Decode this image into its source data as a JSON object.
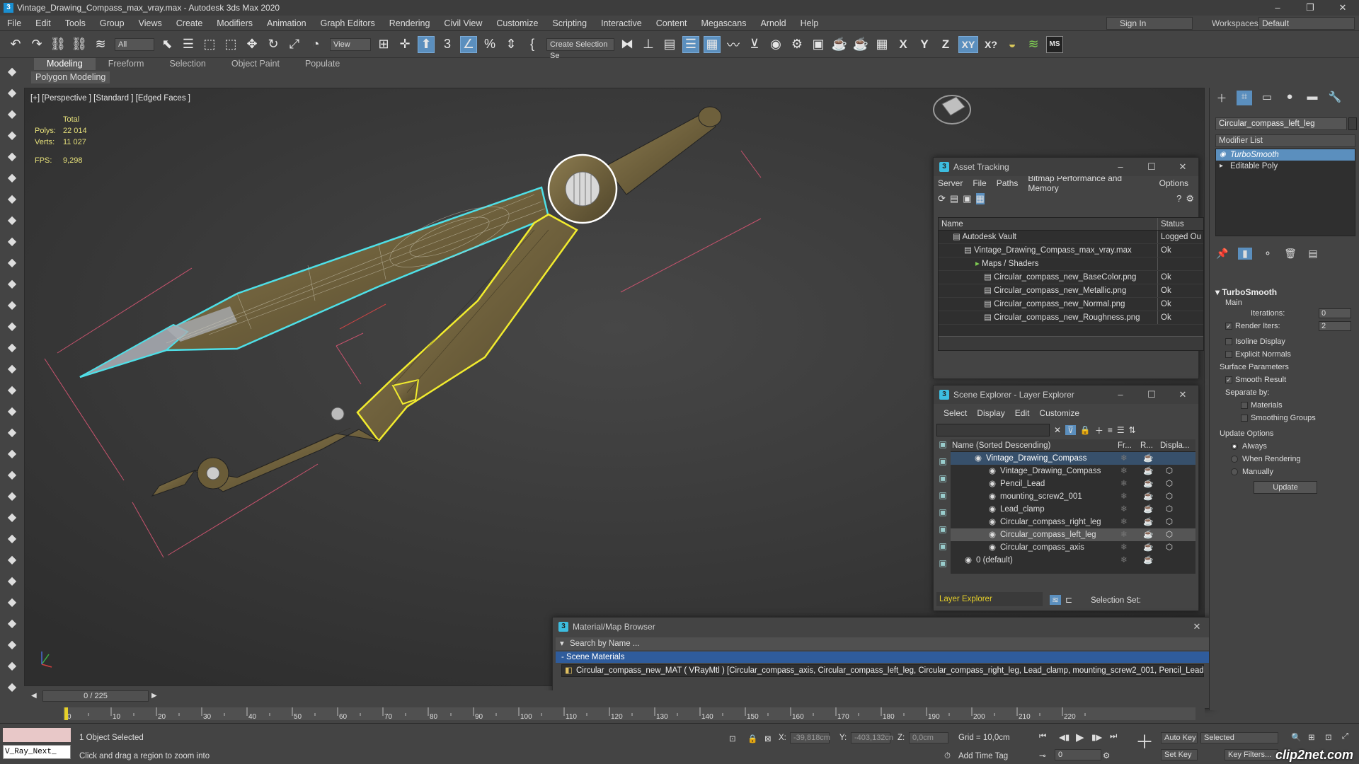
{
  "app": {
    "title": "Vintage_Drawing_Compass_max_vray.max - Autodesk 3ds Max 2020",
    "icon": "3",
    "accent": "#5b8fbe"
  },
  "window_controls": {
    "minimize": "–",
    "maximize": "❐",
    "close": "✕"
  },
  "menu": [
    "File",
    "Edit",
    "Tools",
    "Group",
    "Views",
    "Create",
    "Modifiers",
    "Animation",
    "Graph Editors",
    "Rendering",
    "Civil View",
    "Customize",
    "Scripting",
    "Interactive",
    "Content",
    "Megascans",
    "Arnold",
    "Help"
  ],
  "signin": "Sign In",
  "workspaces": {
    "label": "Workspaces:",
    "value": "Default"
  },
  "toolbar": {
    "filter": "All",
    "view": "View",
    "selection_set": "Create Selection Se",
    "axis_x": "X",
    "axis_y": "Y",
    "axis_z": "Z",
    "axis_xy": "XY",
    "axis_xq": "X?",
    "ms_label": "MS"
  },
  "ribbon": {
    "tabs": [
      "Modeling",
      "Freeform",
      "Selection",
      "Object Paint",
      "Populate"
    ],
    "sub": "Polygon Modeling"
  },
  "viewport": {
    "label": "[+] [Perspective ] [Standard ] [Edged Faces ]",
    "stats": {
      "total": "Total",
      "polys_label": "Polys:",
      "polys": "22 014",
      "verts_label": "Verts:",
      "verts": "11 027",
      "fps_label": "FPS:",
      "fps": "9,298"
    }
  },
  "command_panel": {
    "object_name": "Circular_compass_left_leg",
    "modifier_list": "Modifier List",
    "stack": [
      "TurboSmooth",
      "Editable Poly"
    ],
    "turbosmooth": {
      "title": "TurboSmooth",
      "main": "Main",
      "iterations_label": "Iterations:",
      "iterations": "0",
      "render_iters_label": "Render Iters:",
      "render_iters": "2",
      "isoline": "Isoline Display",
      "explicit": "Explicit Normals",
      "surface": "Surface Parameters",
      "smooth": "Smooth Result",
      "separate": "Separate by:",
      "materials": "Materials",
      "smoothing": "Smoothing Groups",
      "update_options": "Update Options",
      "always": "Always",
      "when_rendering": "When Rendering",
      "manually": "Manually",
      "update_btn": "Update"
    }
  },
  "asset_tracking": {
    "title": "Asset Tracking",
    "menu": [
      "Server",
      "File",
      "Paths",
      "Bitmap Performance and Memory",
      "Options"
    ],
    "col_name": "Name",
    "col_status": "Status",
    "rows": [
      {
        "name": "Autodesk Vault",
        "status": "Logged Ou"
      },
      {
        "name": "Vintage_Drawing_Compass_max_vray.max",
        "status": "Ok"
      },
      {
        "name": "Maps / Shaders",
        "status": ""
      },
      {
        "name": "Circular_compass_new_BaseColor.png",
        "status": "Ok"
      },
      {
        "name": "Circular_compass_new_Metallic.png",
        "status": "Ok"
      },
      {
        "name": "Circular_compass_new_Normal.png",
        "status": "Ok"
      },
      {
        "name": "Circular_compass_new_Roughness.png",
        "status": "Ok"
      }
    ]
  },
  "scene_explorer": {
    "title": "Scene Explorer - Layer Explorer",
    "menu": [
      "Select",
      "Display",
      "Edit",
      "Customize"
    ],
    "col_name": "Name (Sorted Descending)",
    "col_fr": "Fr...",
    "col_r": "R...",
    "col_disp": "Displa...",
    "rows": [
      {
        "name": "Vintage_Drawing_Compass"
      },
      {
        "name": "Vintage_Drawing_Compass"
      },
      {
        "name": "Pencil_Lead"
      },
      {
        "name": "mounting_screw2_001"
      },
      {
        "name": "Lead_clamp"
      },
      {
        "name": "Circular_compass_right_leg"
      },
      {
        "name": "Circular_compass_left_leg"
      },
      {
        "name": "Circular_compass_axis"
      },
      {
        "name": "0 (default)"
      }
    ],
    "footer": "Layer Explorer",
    "selection_set": "Selection Set:"
  },
  "material_browser": {
    "title": "Material/Map Browser",
    "search": "Search by Name ...",
    "section": "- Scene Materials",
    "item": "Circular_compass_new_MAT ( VRayMtl ) [Circular_compass_axis, Circular_compass_left_leg, Circular_compass_right_leg, Lead_clamp, mounting_screw2_001, Pencil_Lead]"
  },
  "timeline": {
    "frame": "0 / 225",
    "ticks": [
      "0",
      "10",
      "20",
      "30",
      "40",
      "50",
      "60",
      "70",
      "80",
      "90",
      "100",
      "110",
      "120",
      "130",
      "140",
      "150",
      "160",
      "170",
      "180",
      "190",
      "200",
      "210",
      "220"
    ]
  },
  "status": {
    "maxscript": "V_Ray_Next_",
    "selected": "1 Object Selected",
    "hint": "Click and drag a region to zoom into",
    "x_label": "X:",
    "x": "-39,818cm",
    "y_label": "Y:",
    "y": "-403,132cn",
    "z_label": "Z:",
    "z": "0,0cm",
    "grid": "Grid = 10,0cm",
    "add_time_tag": "Add Time Tag",
    "auto_key": "Auto Key",
    "auto_key_sel": "Selected",
    "set_key": "Set Key",
    "key_filters": "Key Filters...",
    "frame_field": "0",
    "watermark": "clip2net.com"
  }
}
